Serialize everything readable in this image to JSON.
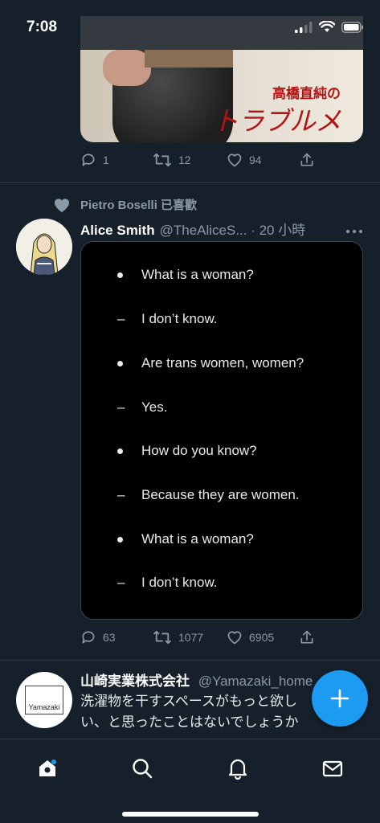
{
  "status_bar": {
    "time": "7:08"
  },
  "previous_tweet": {
    "image_caption_small": "高橋直純の",
    "image_caption_big": "トラブルメーカー",
    "reply_count": "1",
    "retweet_count": "12",
    "like_count": "94"
  },
  "liked_tweet": {
    "liked_by": "Pietro Boselli 已喜歡",
    "display_name": "Alice Smith",
    "handle_time": "@TheAliceS... · 20 小時",
    "dialogue": [
      {
        "marker": "bullet",
        "text": "What is a woman?"
      },
      {
        "marker": "–",
        "text": "I don’t know."
      },
      {
        "marker": "bullet",
        "text": "Are trans women, women?"
      },
      {
        "marker": "–",
        "text": "Yes."
      },
      {
        "marker": "bullet",
        "text": "How do you know?"
      },
      {
        "marker": "–",
        "text": "Because they are women."
      },
      {
        "marker": "bullet",
        "text": "What is a woman?"
      },
      {
        "marker": "–",
        "text": "I don’t know."
      }
    ],
    "reply_count": "63",
    "retweet_count": "1077",
    "like_count": "6905"
  },
  "next_tweet": {
    "display_name": "山崎実業株式会社",
    "handle": "@Yamazaki_home",
    "avatar_text": "Yamazaki",
    "text_line1": "洗濯物を干すスペースがもっと欲し",
    "text_line2": "い、と思ったことはないでしょうか"
  },
  "colors": {
    "background": "#15202b",
    "accent": "#1d9bf0",
    "secondary_text": "#8b98a5",
    "divider": "#2f3b47"
  },
  "tab_bar": {
    "tabs": [
      "home-icon",
      "search-icon",
      "notifications-icon",
      "messages-icon"
    ]
  }
}
